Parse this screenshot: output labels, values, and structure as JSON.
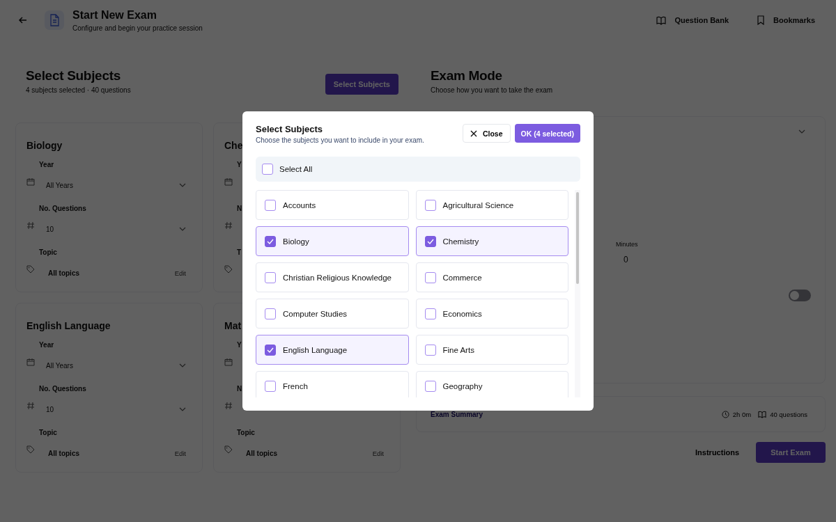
{
  "header": {
    "title": "Start New Exam",
    "subtitle": "Configure and begin your practice session",
    "links": [
      {
        "kind": "book",
        "label": "Question Bank"
      },
      {
        "kind": "bookmark",
        "label": "Bookmarks"
      }
    ]
  },
  "subjects_section": {
    "title": "Select Subjects",
    "summary": "4 subjects selected · 40 questions",
    "button": "Select Subjects"
  },
  "cards": [
    {
      "title": "Biology",
      "fields": [
        {
          "kind": "year",
          "label": "Year",
          "value": "All Years"
        },
        {
          "kind": "count",
          "label": "No. Questions",
          "value": "10"
        },
        {
          "kind": "topic",
          "label": "Topic",
          "value": "All topics",
          "action": "Edit"
        }
      ]
    },
    {
      "title": "Che",
      "fields": [
        {
          "kind": "year",
          "label": "Y"
        },
        {
          "kind": "count",
          "label": "N"
        },
        {
          "kind": "topic",
          "label": "T"
        }
      ]
    },
    {
      "title": "English Language",
      "fields": [
        {
          "kind": "year",
          "label": "Year",
          "value": "All Years"
        },
        {
          "kind": "count",
          "label": "No. Questions",
          "value": "10"
        },
        {
          "kind": "topic",
          "label": "Topic",
          "value": "All topics",
          "action": "Edit"
        }
      ]
    },
    {
      "title": "Mat",
      "fields": [
        {
          "kind": "year",
          "label": "Y"
        },
        {
          "kind": "count",
          "label": "N"
        },
        {
          "kind": "topic",
          "label": "Topic",
          "value": "All topics",
          "action": "Edit"
        }
      ]
    }
  ],
  "exam_mode": {
    "title": "Exam Mode",
    "subtitle": "Choose how you want to take the exam",
    "minutes_label": "Minutes",
    "minutes_value": "0",
    "toggle_on": false
  },
  "summary": {
    "title": "Exam Summary",
    "duration": "2h 0m",
    "questions": "40 questions"
  },
  "actions": {
    "instructions": "Instructions",
    "start": "Start Exam"
  },
  "modal": {
    "title": "Select Subjects",
    "subtitle": "Choose the subjects you want to include in your exam.",
    "close": "Close",
    "ok": "OK (4 selected)",
    "select_all": {
      "label": "Select All",
      "checked": false
    },
    "subjects": [
      {
        "label": "Accounts",
        "checked": false
      },
      {
        "label": "Agricultural Science",
        "checked": false
      },
      {
        "label": "Biology",
        "checked": true
      },
      {
        "label": "Chemistry",
        "checked": true
      },
      {
        "label": "Christian Religious Knowledge",
        "checked": false
      },
      {
        "label": "Commerce",
        "checked": false
      },
      {
        "label": "Computer Studies",
        "checked": false
      },
      {
        "label": "Economics",
        "checked": false
      },
      {
        "label": "English Language",
        "checked": true
      },
      {
        "label": "Fine Arts",
        "checked": false
      },
      {
        "label": "French",
        "checked": false
      },
      {
        "label": "Geography",
        "checked": false
      }
    ]
  }
}
